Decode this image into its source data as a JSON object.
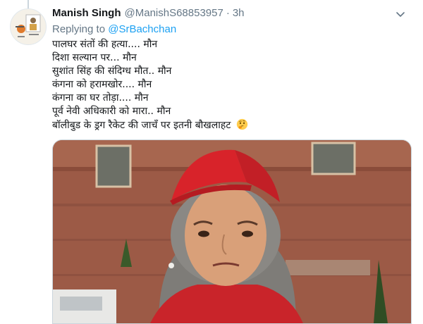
{
  "tweet": {
    "display_name": "Manish Singh",
    "handle": "@ManishS68853957",
    "separator": "·",
    "time": "3h",
    "replying_prefix": "Replying to",
    "replying_to": "@SrBachchan",
    "lines": [
      "पालघर संतों की हत्या.... मौन",
      "दिशा सल्यान पर... मौन",
      "सुशांत सिंह की संदिग्ध मौत.. मौन",
      "कंगना को हरामखोर.... मौन",
      "कंगना का घर तोड़ा.... मौन",
      "पूर्व नेवी अधिकारी को मारा.. मौन",
      "बॉलीबुड के ड्रग रैकेट की जाचँ पर इतनी बौखलाहट"
    ],
    "emoji": "thinking-face-emoji",
    "more_icon": "chevron-down-icon"
  },
  "colors": {
    "link": "#1da1f2",
    "muted": "#657786",
    "text": "#14171a"
  }
}
